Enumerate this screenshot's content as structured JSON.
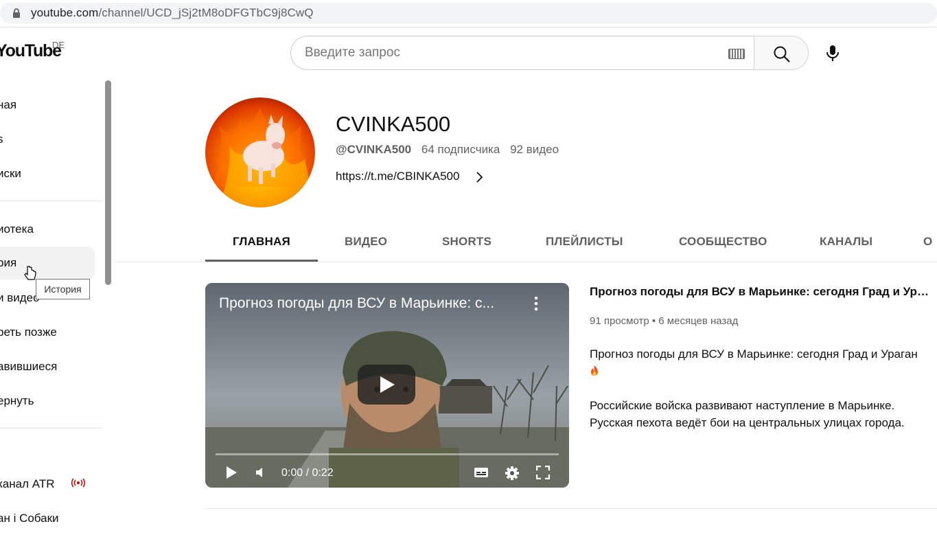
{
  "browser": {
    "url_host": "youtube.com",
    "url_path": "/channel/UCD_jSj2tM8oDFGTbC9j8CwQ"
  },
  "header": {
    "logo": "YouTube",
    "region": "DE",
    "search_placeholder": "Введите запрос"
  },
  "sidebar": {
    "items": [
      {
        "label": "ная"
      },
      {
        "label": "s"
      },
      {
        "label": "иски"
      },
      {
        "label": "иотека"
      },
      {
        "label": "рия"
      },
      {
        "label": "и видео"
      },
      {
        "label": "реть позже"
      },
      {
        "label": "авившиеся"
      },
      {
        "label": "ернуть"
      },
      {
        "label": "канал ATR"
      },
      {
        "label": "ан і Собаки"
      }
    ],
    "tooltip": "История"
  },
  "channel": {
    "name": "CVINKA500",
    "handle": "@CVINKA500",
    "subscribers": "64 подписчика",
    "videos": "92 видео",
    "link": "https://t.me/CBINKA500"
  },
  "tabs": [
    {
      "label": "ГЛАВНАЯ"
    },
    {
      "label": "ВИДЕО"
    },
    {
      "label": "SHORTS"
    },
    {
      "label": "ПЛЕЙЛИСТЫ"
    },
    {
      "label": "СООБЩЕСТВО"
    },
    {
      "label": "КАНАЛЫ"
    },
    {
      "label": "О"
    }
  ],
  "video": {
    "player_title": "Прогноз погоды для ВСУ в Марьинке: с...",
    "time": "0:00 / 0:22",
    "title": "Прогноз погоды для ВСУ в Марьинке: сегодня Град и Ураг...",
    "meta": "91 просмотр • 6 месяцев назад",
    "desc_line1": "Прогноз погоды для ВСУ в Марьинке: сегодня Град и Ураган",
    "desc_line2": "Российские войска развивают наступление в Марьинке.",
    "desc_line3": "Русская пехота ведёт бои на центральных улицах города."
  }
}
